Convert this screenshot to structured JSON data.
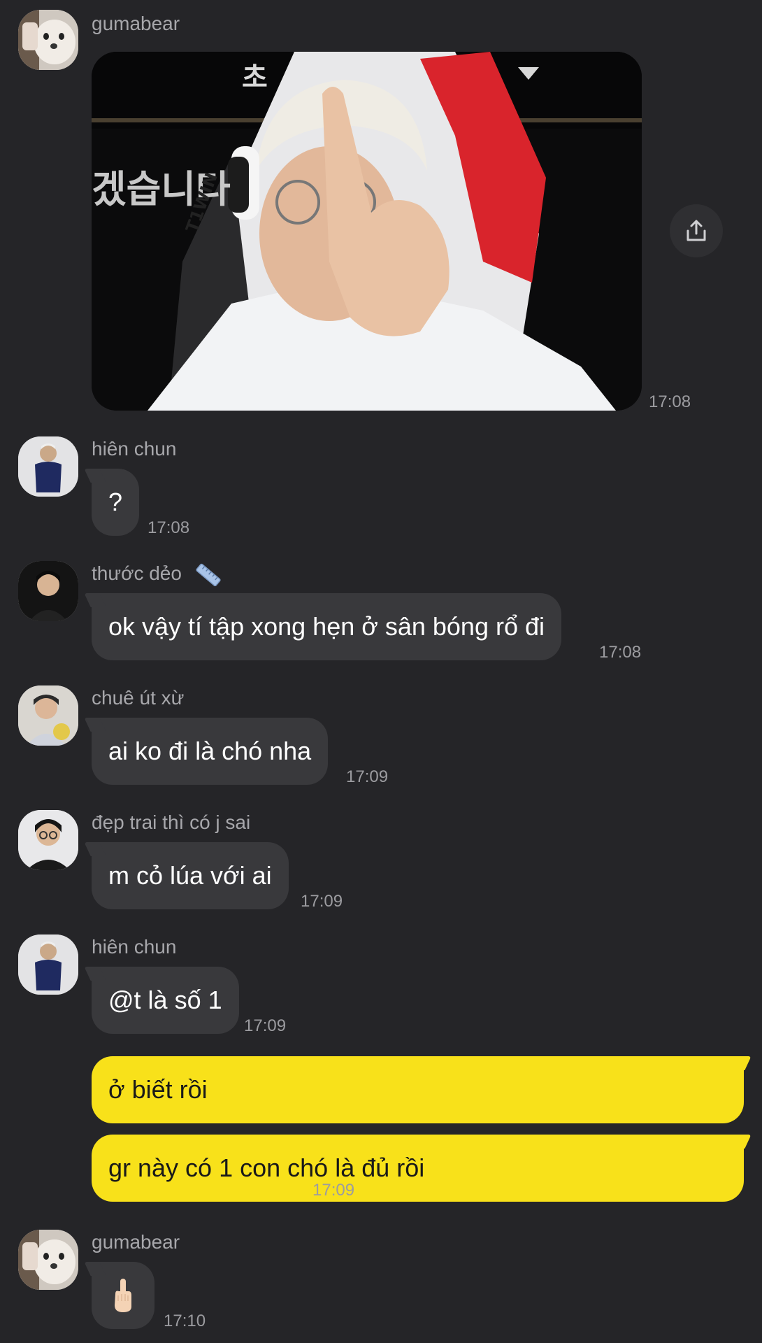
{
  "messages": [
    {
      "sender": "gumabear",
      "type": "image",
      "time": "17:08"
    },
    {
      "sender": "hiên chun",
      "text": "?",
      "time": "17:08"
    },
    {
      "sender": "thước dẻo",
      "text": "ok vậy tí tập xong hẹn ở sân bóng rổ đi",
      "time": "17:08"
    },
    {
      "sender": "chuê út xừ",
      "text": "ai ko đi là chó nha",
      "time": "17:09"
    },
    {
      "sender": "đẹp trai thì có j sai",
      "text": "m cỏ lúa với ai",
      "time": "17:09"
    },
    {
      "sender": "hiên chun",
      "text": "@t là số 1",
      "time": "17:09"
    },
    {
      "sender": "me",
      "text": "ở biết rồi",
      "time": ""
    },
    {
      "sender": "me",
      "text": "gr này có 1 con chó là đủ rồi",
      "time": "17:09"
    },
    {
      "sender": "gumabear",
      "type": "emoji",
      "text": "middle-finger-emoji",
      "time": "17:10"
    }
  ],
  "image_overlay_text": {
    "top": "초",
    "side": "겠습니다",
    "chair_brand": "T1WIN"
  },
  "colors": {
    "background": "#252528",
    "incoming_bubble": "#39393c",
    "outgoing_bubble": "#f8e11a",
    "sender_name": "#a7a7ab",
    "timestamp": "#9c9ca0"
  },
  "icons": {
    "share": "share-icon",
    "ruler": "ruler-icon"
  }
}
